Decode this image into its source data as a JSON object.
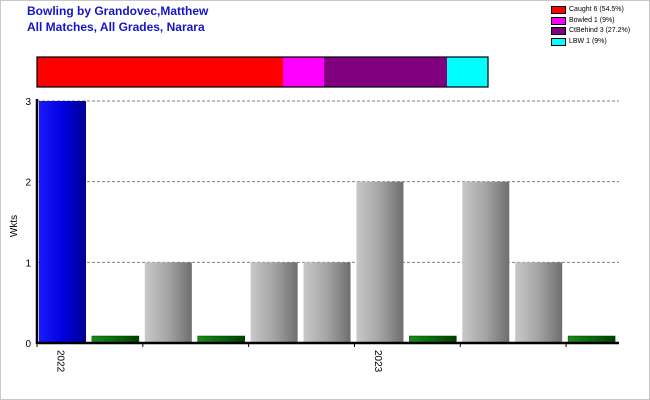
{
  "title_line1": "Bowling by Grandovec,Matthew",
  "title_line2": "All Matches, All Grades, Narara",
  "legend": [
    {
      "label": "Caught 6 (54.5%)",
      "color": "#ff0000"
    },
    {
      "label": "Bowled 1 (9%)",
      "color": "#ff00ff"
    },
    {
      "label": "CtBehind 3 (27.2%)",
      "color": "#800080"
    },
    {
      "label": "LBW 1 (9%)",
      "color": "#00ffff"
    }
  ],
  "chart_data": {
    "type": "bar",
    "ylabel": "Wkts",
    "ylim": [
      0,
      3
    ],
    "yticks": [
      0,
      1,
      2,
      3
    ],
    "grid": true,
    "legend_position": "top-right",
    "x_labels": [
      {
        "label": "2022",
        "index": 0
      },
      {
        "label": "2023",
        "index": 6
      }
    ],
    "values": [
      3,
      0,
      1,
      0,
      1,
      1,
      2,
      0,
      2,
      1,
      0
    ],
    "dismissal_breakdown": [
      {
        "name": "Caught",
        "value": 6
      },
      {
        "name": "Bowled",
        "value": 1
      },
      {
        "name": "CtBehind",
        "value": 3
      },
      {
        "name": "LBW",
        "value": 1
      }
    ]
  }
}
